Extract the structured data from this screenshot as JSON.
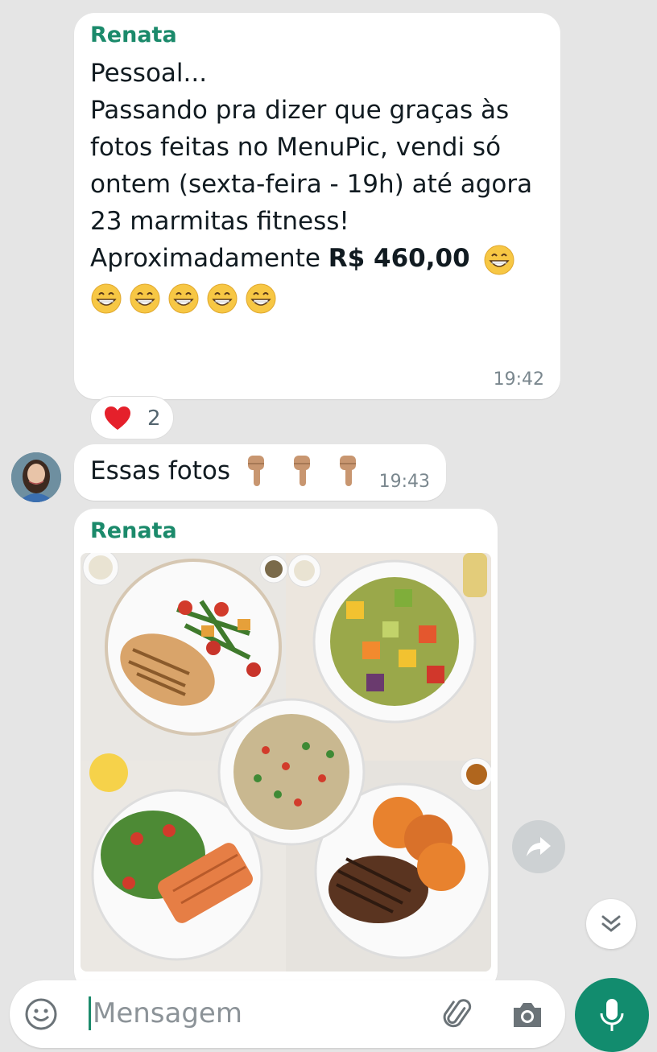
{
  "messages": [
    {
      "sender": "Renata",
      "lines": [
        "Pessoal...",
        "Passando pra dizer que graças às",
        "fotos feitas no MenuPic, vendi só",
        "ontem (sexta-feira - 19h) até agora",
        "23 marmitas fitness!"
      ],
      "last_line_prefix": "Aproximadamente ",
      "last_line_bold": "R$ 460,00",
      "time": "19:42",
      "reaction": {
        "emoji": "heart",
        "count": "2"
      }
    },
    {
      "text": "Essas fotos",
      "time": "19:43"
    },
    {
      "sender": "Renata",
      "image_description_icons": [
        "grilled-chicken-plate",
        "roasted-vegetables-bowl",
        "quinoa-salad-bowl",
        "salmon-salad-plate",
        "steak-sweet-potato-plate"
      ]
    }
  ],
  "composer": {
    "placeholder": "Mensagem"
  },
  "colors": {
    "background": "#e5e5e5",
    "sender_name": "#1b8a6b",
    "mic_button": "#128c6e"
  },
  "icons": [
    "emoji-icon",
    "attach-icon",
    "camera-icon",
    "mic-icon",
    "forward-icon",
    "scroll-down-icon"
  ]
}
